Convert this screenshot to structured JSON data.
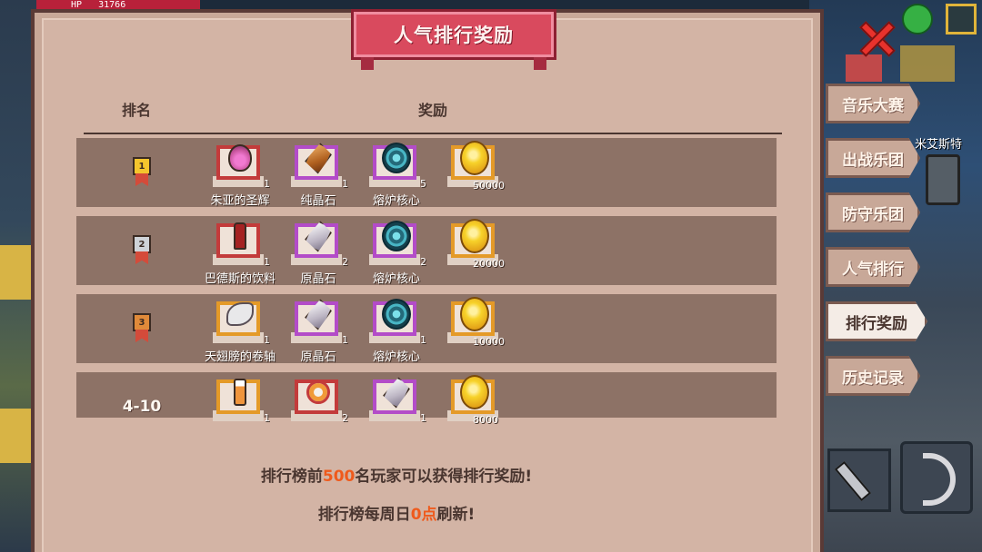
{
  "hud": {
    "hp_label": "HP",
    "hp_value": "31766"
  },
  "panel": {
    "title": "人气排行奖励",
    "col_rank": "排名",
    "col_reward": "奖励"
  },
  "rows": [
    {
      "rank": "1",
      "rank_style": "gold",
      "items": [
        {
          "name": "朱亚的圣辉",
          "qty": "1",
          "frame": "red",
          "icon": "potion"
        },
        {
          "name": "纯晶石",
          "qty": "1",
          "frame": "purple",
          "icon": "crystal-gold"
        },
        {
          "name": "熔炉核心",
          "qty": "5",
          "frame": "purple",
          "icon": "core"
        },
        {
          "name": "",
          "qty": "50000",
          "frame": "gold",
          "icon": "coin"
        }
      ]
    },
    {
      "rank": "2",
      "rank_style": "silver",
      "items": [
        {
          "name": "巴德斯的饮料",
          "qty": "1",
          "frame": "red",
          "icon": "cola"
        },
        {
          "name": "原晶石",
          "qty": "2",
          "frame": "purple",
          "icon": "crystal-grey"
        },
        {
          "name": "熔炉核心",
          "qty": "2",
          "frame": "purple",
          "icon": "core"
        },
        {
          "name": "",
          "qty": "20000",
          "frame": "gold",
          "icon": "coin"
        }
      ]
    },
    {
      "rank": "3",
      "rank_style": "bronze",
      "items": [
        {
          "name": "天翅膀的卷轴",
          "qty": "1",
          "frame": "orange",
          "icon": "wing"
        },
        {
          "name": "原晶石",
          "qty": "1",
          "frame": "purple",
          "icon": "crystal-grey"
        },
        {
          "name": "熔炉核心",
          "qty": "1",
          "frame": "purple",
          "icon": "core"
        },
        {
          "name": "",
          "qty": "10000",
          "frame": "gold",
          "icon": "coin"
        }
      ]
    },
    {
      "rank": "4-10",
      "rank_style": "text",
      "items": [
        {
          "name": "",
          "qty": "1",
          "frame": "orange",
          "icon": "bottle"
        },
        {
          "name": "",
          "qty": "2",
          "frame": "red",
          "icon": "medal"
        },
        {
          "name": "",
          "qty": "1",
          "frame": "purple",
          "icon": "crystal-grey"
        },
        {
          "name": "",
          "qty": "8000",
          "frame": "gold",
          "icon": "coin"
        }
      ]
    }
  ],
  "footer": {
    "line1_pre": "排行榜前",
    "line1_num": "500",
    "line1_post": "名玩家可以获得排行奖励!",
    "line2_pre": "排行榜每周日",
    "line2_num": "0点",
    "line2_post": "刷新!"
  },
  "tabs": [
    {
      "label": "音乐大赛",
      "active": false
    },
    {
      "label": "出战乐团",
      "active": false
    },
    {
      "label": "防守乐团",
      "active": false
    },
    {
      "label": "人气排行",
      "active": false
    },
    {
      "label": "排行奖励",
      "active": true
    },
    {
      "label": "历史记录",
      "active": false
    }
  ],
  "npc_label": "米艾斯特",
  "colors": {
    "frame_red": "#c33b3b",
    "frame_purple": "#b34cc8",
    "frame_orange": "#e49a28",
    "highlight": "#ef5a1c",
    "medal_gold": "#f4c52d",
    "medal_silver": "#cfd3d8",
    "medal_bronze": "#e08a3a"
  }
}
